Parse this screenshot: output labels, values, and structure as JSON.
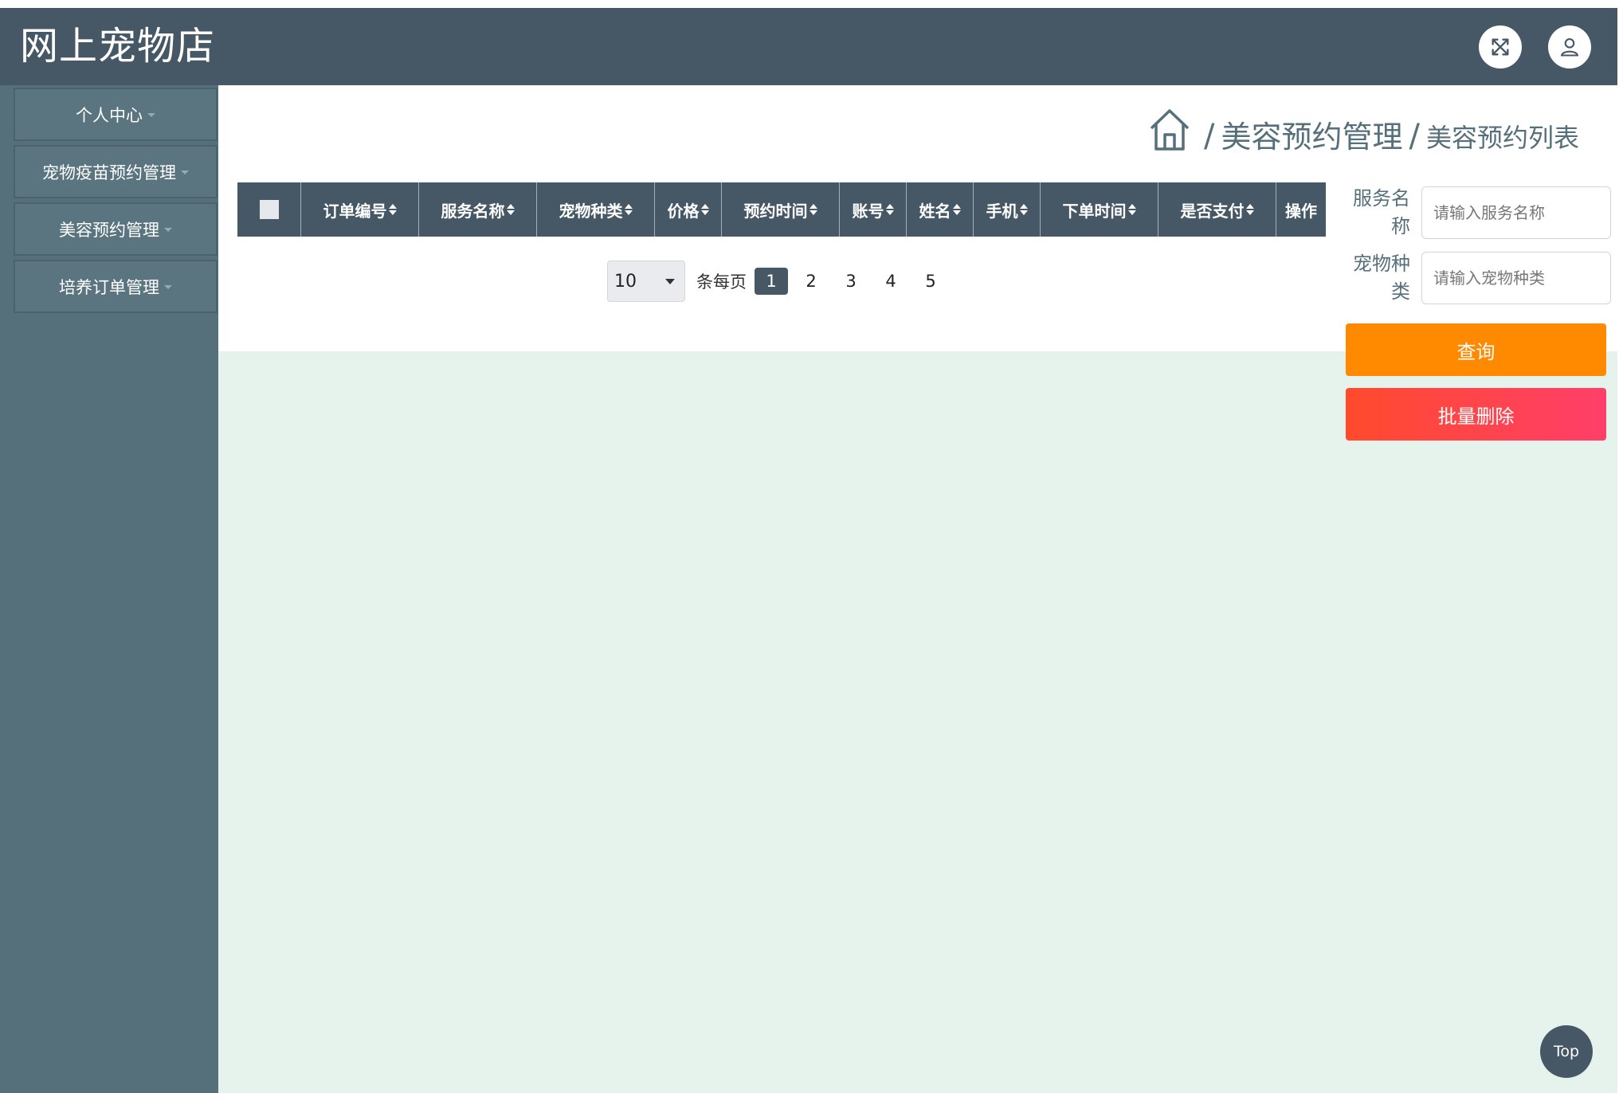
{
  "header": {
    "title": "网上宠物店",
    "fullscreen_icon": "expand-arrows-icon",
    "user_icon": "user-icon"
  },
  "sidebar": {
    "items": [
      {
        "label": "个人中心"
      },
      {
        "label": "宠物疫苗预约管理"
      },
      {
        "label": "美容预约管理"
      },
      {
        "label": "培养订单管理"
      }
    ]
  },
  "breadcrumb": {
    "home_icon": "home-icon",
    "separator": "/",
    "level1": "美容预约管理",
    "level2": "美容预约列表"
  },
  "table": {
    "columns": [
      {
        "label": "订单编号"
      },
      {
        "label": "服务名称"
      },
      {
        "label": "宠物种类"
      },
      {
        "label": "价格"
      },
      {
        "label": "预约时间"
      },
      {
        "label": "账号"
      },
      {
        "label": "姓名"
      },
      {
        "label": "手机"
      },
      {
        "label": "下单时间"
      },
      {
        "label": "是否支付"
      },
      {
        "label": "操作"
      }
    ]
  },
  "pagination": {
    "page_size": "10",
    "per_page_label": "条每页",
    "pages": [
      "1",
      "2",
      "3",
      "4",
      "5"
    ],
    "current_page": "1"
  },
  "filters": {
    "service_name_label": "服务名称",
    "service_name_placeholder": "请输入服务名称",
    "pet_type_label": "宠物种类",
    "pet_type_placeholder": "请输入宠物种类",
    "query_button": "查询",
    "batch_delete_button": "批量删除"
  },
  "back_to_top": "Top",
  "colors": {
    "header_bg": "#465866",
    "sidebar_bg": "#556f7b",
    "content_bg": "#e6f3ec",
    "query_button": "#ff8a00",
    "delete_button": "#ff4a2c"
  }
}
